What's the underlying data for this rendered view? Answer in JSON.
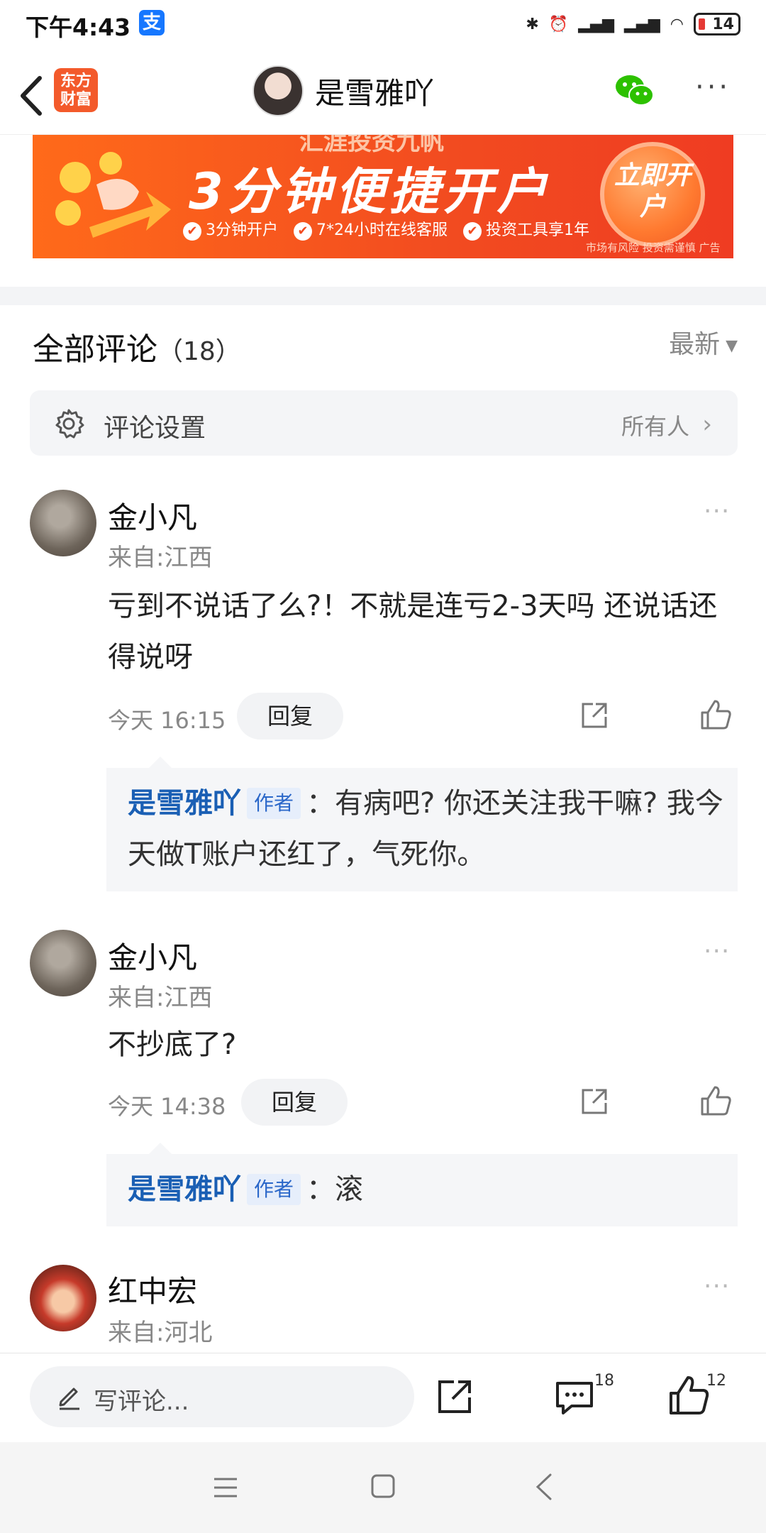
{
  "status_bar": {
    "time": "下午4:43",
    "battery": "14",
    "pay_icon": "支"
  },
  "header": {
    "back_label": "‹",
    "logo_text": "东方财富",
    "title": "是雪雅吖"
  },
  "ad": {
    "top_text": "汇涯投资九帆",
    "headline": "3分钟便捷开户",
    "features": [
      "3分钟开户",
      "7*24小时在线客服",
      "投资工具享1年"
    ],
    "button": "立即开户",
    "risk": "市场有风险 投资需谨慎 广告"
  },
  "comments_header": {
    "title": "全部评论",
    "count": "（18）",
    "sort": "最新"
  },
  "settings": {
    "label": "评论设置",
    "value": "所有人"
  },
  "comments": [
    {
      "name": "金小凡",
      "location": "来自:江西",
      "text": "亏到不说话了么?！不就是连亏2-3天吗 还说话还得说呀",
      "time": "今天 16:15",
      "reply_label": "回复",
      "reply": {
        "author": "是雪雅吖",
        "tag": "作者",
        "text": "：有病吧? 你还关注我干嘛? 我今天做T账户还红了，气死你。"
      }
    },
    {
      "name": "金小凡",
      "location": "来自:江西",
      "text": "不抄底了?",
      "time": "今天 14:38",
      "reply_label": "回复",
      "reply": {
        "author": "是雪雅吖",
        "tag": "作者",
        "text": "：滚"
      }
    },
    {
      "name": "红中宏",
      "location": "来自:河北"
    }
  ],
  "bottom_bar": {
    "placeholder": "写评论...",
    "comment_count": "18",
    "like_count": "12"
  },
  "colors": {
    "accent": "#1a5fb4",
    "brand": "#f24b20"
  }
}
